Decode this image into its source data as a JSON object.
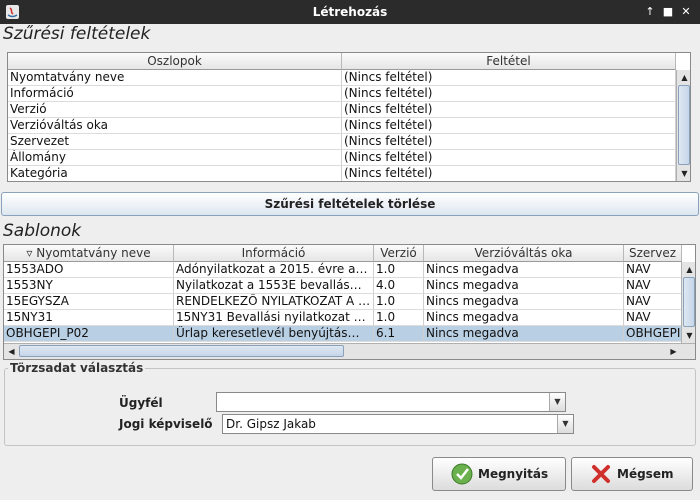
{
  "window": {
    "title": "Létrehozás",
    "icons": [
      "java-app-icon",
      "pin-icon",
      "maximize-icon",
      "close-icon"
    ]
  },
  "filter": {
    "title": "Szűrési feltételek",
    "columns": [
      "Oszlopok",
      "Feltétel"
    ],
    "rows": [
      [
        "Nyomtatvány neve",
        "(Nincs feltétel)"
      ],
      [
        "Információ",
        "(Nincs feltétel)"
      ],
      [
        "Verzió",
        "(Nincs feltétel)"
      ],
      [
        "Verzióváltás oka",
        "(Nincs feltétel)"
      ],
      [
        "Szervezet",
        "(Nincs feltétel)"
      ],
      [
        "Állomány",
        "(Nincs feltétel)"
      ],
      [
        "Kategória",
        "(Nincs feltétel)"
      ]
    ],
    "clear_button": "Szűrési feltételek törlése"
  },
  "templates": {
    "title": "Sablonok",
    "sort_indicator": "▿",
    "columns": [
      "Nyomtatvány neve",
      "Információ",
      "Verzió",
      "Verzióváltás oka",
      "Szervez"
    ],
    "rows": [
      [
        "1553ADO",
        "Adónyilatkozat a 2015. évre a…",
        "1.0",
        "Nincs megadva",
        "NAV"
      ],
      [
        "1553NY",
        "Nyilatkozat a 1553E bevallás…",
        "4.0",
        "Nincs megadva",
        "NAV"
      ],
      [
        "15EGYSZA",
        "RENDELKEZŐ NYILATKOZAT A …",
        "1.0",
        "Nincs megadva",
        "NAV"
      ],
      [
        "15NY31",
        "15NY31 Bevallási nyilatkozat …",
        "1.0",
        "Nincs megadva",
        "NAV"
      ],
      [
        "OBHGEPI_P02",
        "Űrlap keresetlevél benyújtás…",
        "6.1",
        "Nincs megadva",
        "OBHGEPI"
      ]
    ],
    "selected_index": 4
  },
  "master": {
    "title": "Törzsadat választás",
    "client_label": "Ügyfél",
    "client_value": "",
    "rep_label": "Jogi képviselő",
    "rep_value": "Dr. Gipsz Jakab"
  },
  "buttons": {
    "open": "Megnyitás",
    "cancel": "Mégsem"
  },
  "colors": {
    "titlebar": "#2b2b2b",
    "selection": "#b9cfe4",
    "accent": "#8aa1bc"
  }
}
